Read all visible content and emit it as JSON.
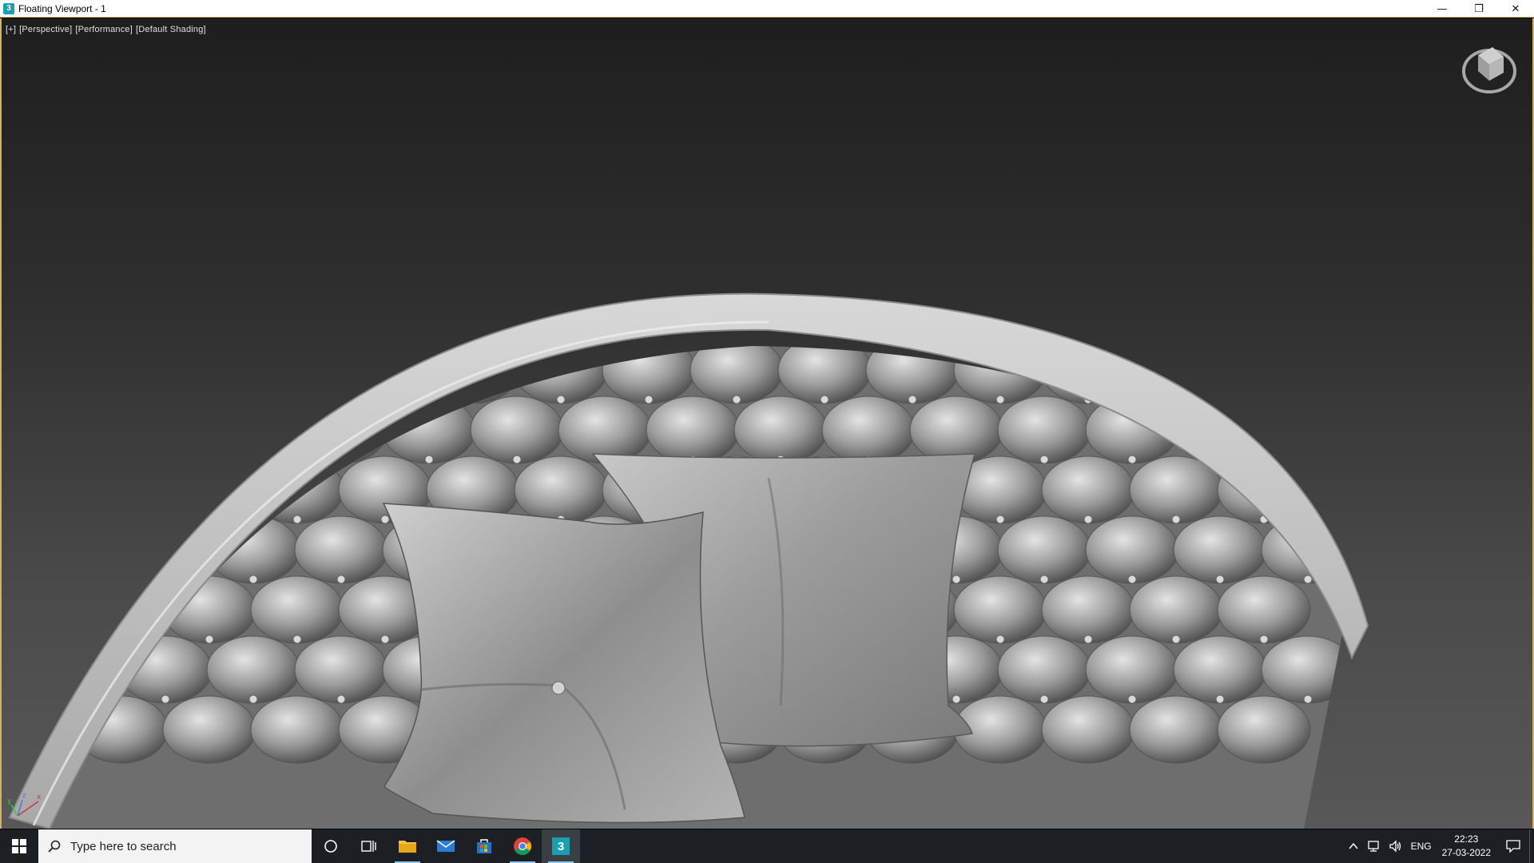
{
  "window": {
    "title": "Floating Viewport - 1",
    "app_icon_glyph": "3",
    "controls": {
      "minimize": "—",
      "restore": "❐",
      "close": "✕"
    }
  },
  "viewport": {
    "labels": [
      "[+]",
      "[Perspective]",
      "[Performance]",
      "[Default Shading]"
    ],
    "scene_description_icon": "tufted-sofa-3d-model",
    "axis_labels": {
      "x": "x",
      "y": "y",
      "z": "z"
    }
  },
  "taskbar": {
    "search_placeholder": "Type here to search",
    "apps": [
      {
        "name": "cortana-icon"
      },
      {
        "name": "task-view-icon"
      },
      {
        "name": "file-explorer-icon"
      },
      {
        "name": "mail-icon"
      },
      {
        "name": "store-icon"
      },
      {
        "name": "chrome-icon"
      },
      {
        "name": "3ds-max-icon",
        "active": true,
        "glyph": "3"
      }
    ],
    "tray": {
      "language": "ENG",
      "time": "22:23",
      "date": "27-03-2022"
    }
  },
  "colors": {
    "viewport_border": "#d6b25c",
    "taskbar": "#1c1f24",
    "app_accent": "#1a9eb0"
  }
}
